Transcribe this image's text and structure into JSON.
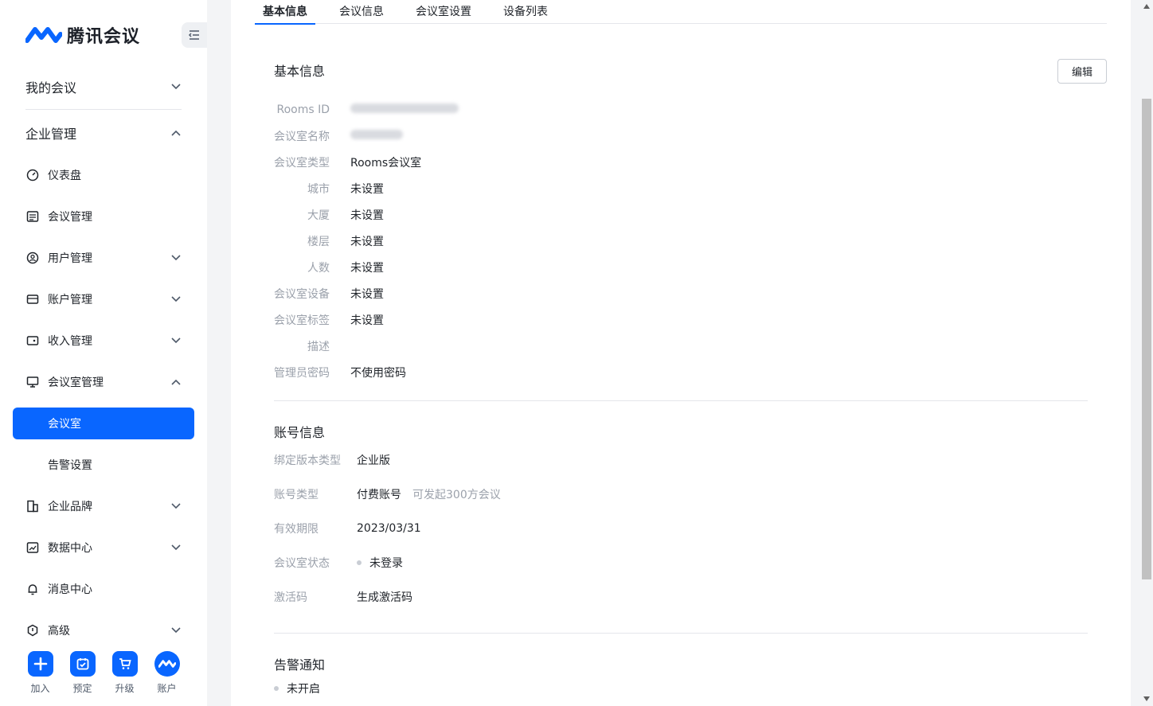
{
  "app": {
    "name": "腾讯会议"
  },
  "sidebar": {
    "top": [
      {
        "label": "我的会议"
      },
      {
        "label": "企业管理"
      }
    ],
    "items": [
      {
        "label": "仪表盘"
      },
      {
        "label": "会议管理"
      },
      {
        "label": "用户管理"
      },
      {
        "label": "账户管理"
      },
      {
        "label": "收入管理"
      },
      {
        "label": "会议室管理"
      },
      {
        "label": "会议室"
      },
      {
        "label": "告警设置"
      },
      {
        "label": "企业品牌"
      },
      {
        "label": "数据中心"
      },
      {
        "label": "消息中心"
      },
      {
        "label": "高级"
      }
    ],
    "bottom": [
      {
        "label": "加入"
      },
      {
        "label": "预定"
      },
      {
        "label": "升级"
      },
      {
        "label": "账户"
      }
    ]
  },
  "tabs": [
    "基本信息",
    "会议信息",
    "会议室设置",
    "设备列表"
  ],
  "basic": {
    "title": "基本信息",
    "edit": "编辑",
    "rows": [
      {
        "k": "Rooms ID",
        "v": ""
      },
      {
        "k": "会议室名称",
        "v": ""
      },
      {
        "k": "会议室类型",
        "v": "Rooms会议室"
      },
      {
        "k": "城市",
        "v": "未设置"
      },
      {
        "k": "大厦",
        "v": "未设置"
      },
      {
        "k": "楼层",
        "v": "未设置"
      },
      {
        "k": "人数",
        "v": "未设置"
      },
      {
        "k": "会议室设备",
        "v": "未设置"
      },
      {
        "k": "会议室标签",
        "v": "未设置"
      },
      {
        "k": "描述",
        "v": ""
      },
      {
        "k": "管理员密码",
        "v": "不使用密码"
      }
    ]
  },
  "account": {
    "title": "账号信息",
    "rows": [
      {
        "k": "绑定版本类型",
        "v": "企业版"
      },
      {
        "k": "账号类型",
        "v": "付费账号",
        "note": "可发起300方会议"
      },
      {
        "k": "有效期限",
        "v": "2023/03/31"
      },
      {
        "k": "会议室状态",
        "v": "未登录"
      },
      {
        "k": "激活码",
        "v": "生成激活码"
      }
    ]
  },
  "alert": {
    "title": "告警通知",
    "status": "未开启"
  },
  "colors": {
    "accent": "#0966ff"
  }
}
